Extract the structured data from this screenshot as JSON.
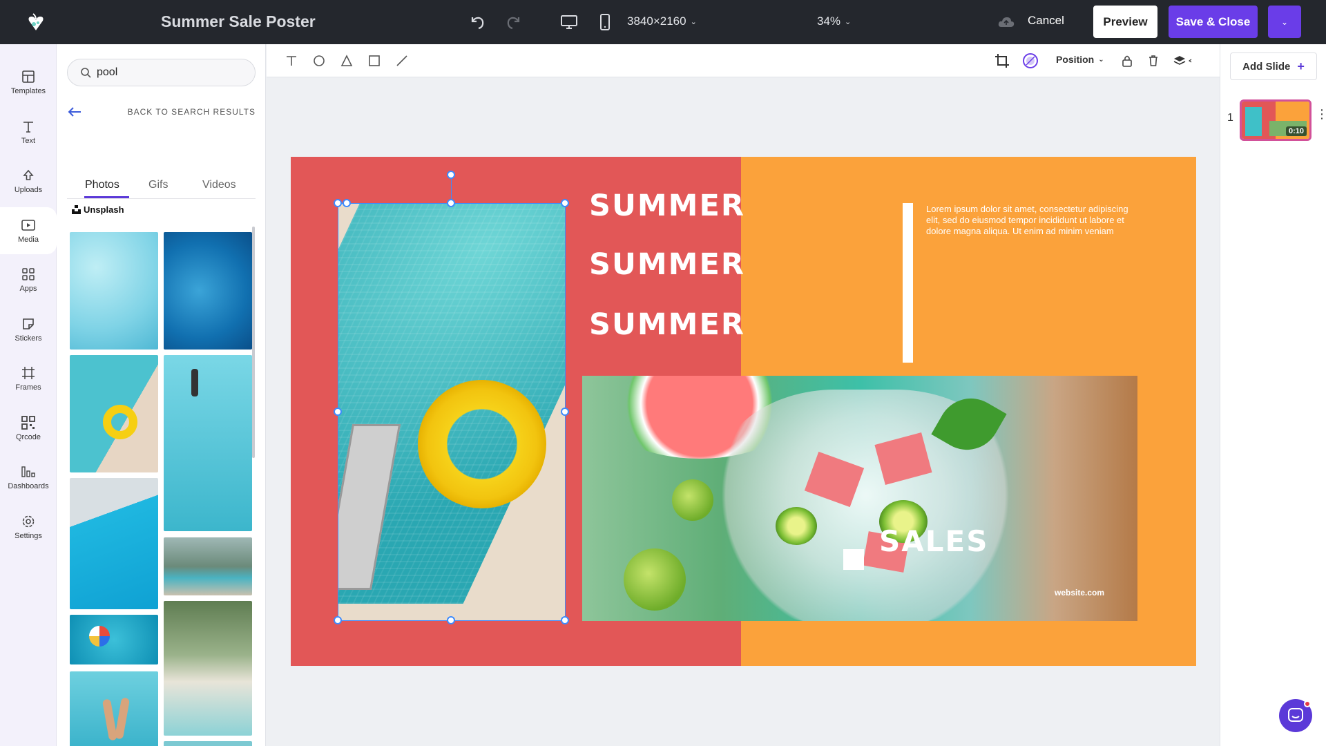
{
  "header": {
    "title": "Summer Sale Poster",
    "resolution": "3840×2160",
    "zoom": "34%",
    "cancel_label": "Cancel",
    "preview_label": "Preview",
    "save_label": "Save & Close"
  },
  "rail": {
    "items": [
      {
        "label": "Templates",
        "icon": "templates-icon"
      },
      {
        "label": "Text",
        "icon": "text-icon"
      },
      {
        "label": "Uploads",
        "icon": "upload-icon"
      },
      {
        "label": "Media",
        "icon": "media-icon"
      },
      {
        "label": "Apps",
        "icon": "apps-icon"
      },
      {
        "label": "Stickers",
        "icon": "sticker-icon"
      },
      {
        "label": "Frames",
        "icon": "frame-icon"
      },
      {
        "label": "Qrcode",
        "icon": "qrcode-icon"
      },
      {
        "label": "Dashboards",
        "icon": "dashboard-icon"
      },
      {
        "label": "Settings",
        "icon": "settings-icon"
      }
    ]
  },
  "media_panel": {
    "search_value": "pool",
    "back_label": "BACK TO SEARCH RESULTS",
    "tabs": [
      "Photos",
      "Gifs",
      "Videos"
    ],
    "active_tab": "Photos",
    "source_label": "Unsplash"
  },
  "toolbar": {
    "position_label": "Position"
  },
  "slides": {
    "add_label": "Add Slide",
    "items": [
      {
        "number": "1",
        "duration": "0:10"
      }
    ]
  },
  "poster": {
    "summer_lines": [
      "SUMMER",
      "SUMMER",
      "SUMMER"
    ],
    "lorem": "Lorem ipsum dolor sit amet, consectetur adipiscing elit, sed do eiusmod tempor incididunt ut labore et dolore magna aliqua. Ut enim ad minim veniam",
    "sales": "SALES",
    "website": "website.com"
  },
  "colors": {
    "accent": "#6a3de8",
    "poster_red": "#e25757",
    "poster_orange": "#fba23b",
    "selection": "#3d8bfd"
  }
}
